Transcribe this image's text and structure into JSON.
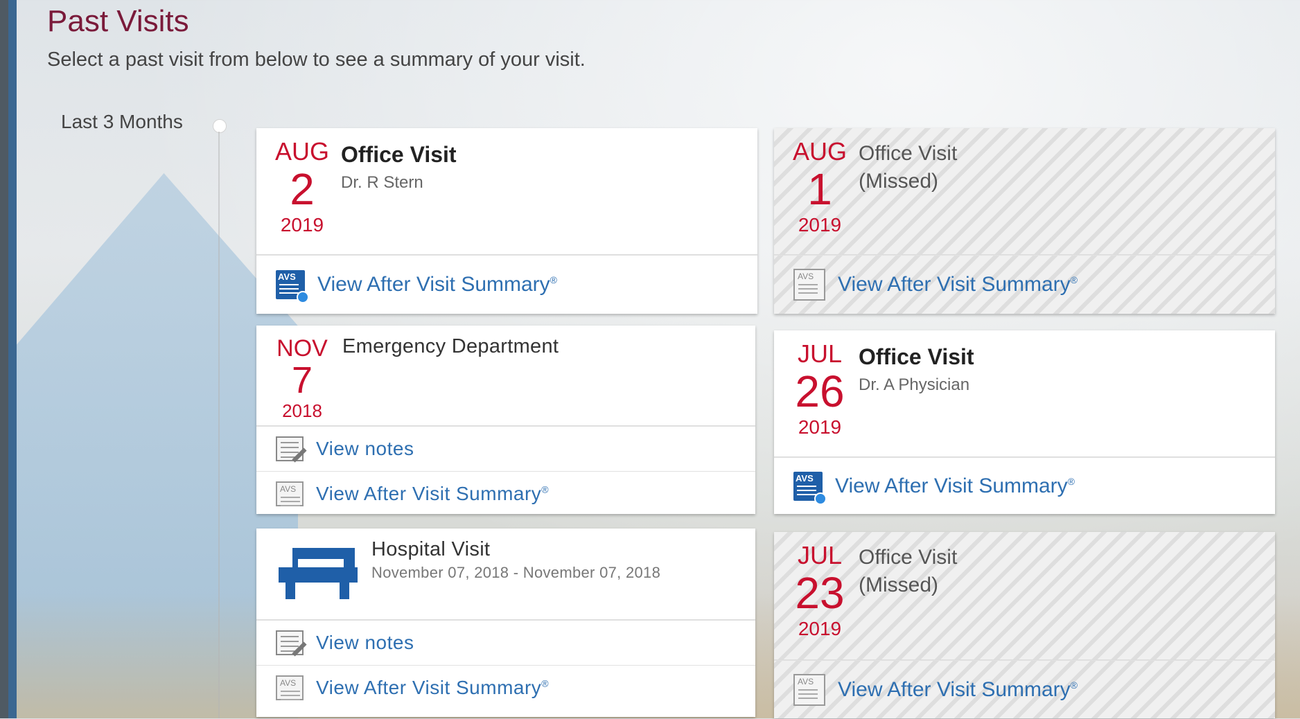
{
  "page": {
    "title": "Past Visits",
    "subtitle": "Select a past visit from below to see a summary of your visit.",
    "range_label": "Last 3 Months"
  },
  "colors": {
    "title": "#7a1a3a",
    "date_red": "#c8102e",
    "link_blue": "#2e6fb1",
    "avs_icon_blue": "#1f5fa8",
    "bed_icon_blue": "#1f5fa8"
  },
  "visits": [
    {
      "month": "AUG",
      "day": "2",
      "year": "2019",
      "type": "Office Visit",
      "provider": "Dr. R Stern",
      "missed": false,
      "avs_label": "View After Visit Summary",
      "avs_mark": "®",
      "avs_icon": "avs-icon-active"
    },
    {
      "month": "AUG",
      "day": "1",
      "year": "2019",
      "type": "Office Visit",
      "missed_label": "(Missed)",
      "missed": true,
      "avs_label": "View After Visit Summary",
      "avs_mark": "®",
      "avs_icon": "avs-icon-inactive"
    },
    {
      "month": "NOV",
      "day": "7",
      "year": "2018",
      "type": "Emergency Department",
      "missed": false,
      "notes_label": "View notes",
      "avs_label": "View After Visit Summary",
      "avs_mark": "®",
      "avs_icon": "avs-icon-inactive"
    },
    {
      "month": "JUL",
      "day": "26",
      "year": "2019",
      "type": "Office Visit",
      "provider": "Dr. A Physician",
      "missed": false,
      "avs_label": "View After Visit Summary",
      "avs_mark": "®",
      "avs_icon": "avs-icon-active"
    },
    {
      "type": "Hospital Visit",
      "dates": "November 07, 2018 - November 07, 2018",
      "icon": "bed-icon",
      "notes_label": "View notes",
      "avs_label": "View After Visit Summary",
      "avs_mark": "®",
      "avs_icon": "avs-icon-inactive"
    },
    {
      "month": "JUL",
      "day": "23",
      "year": "2019",
      "type": "Office Visit",
      "missed_label": "(Missed)",
      "missed": true,
      "avs_label": "View After Visit Summary",
      "avs_mark": "®",
      "avs_icon": "avs-icon-inactive"
    }
  ]
}
